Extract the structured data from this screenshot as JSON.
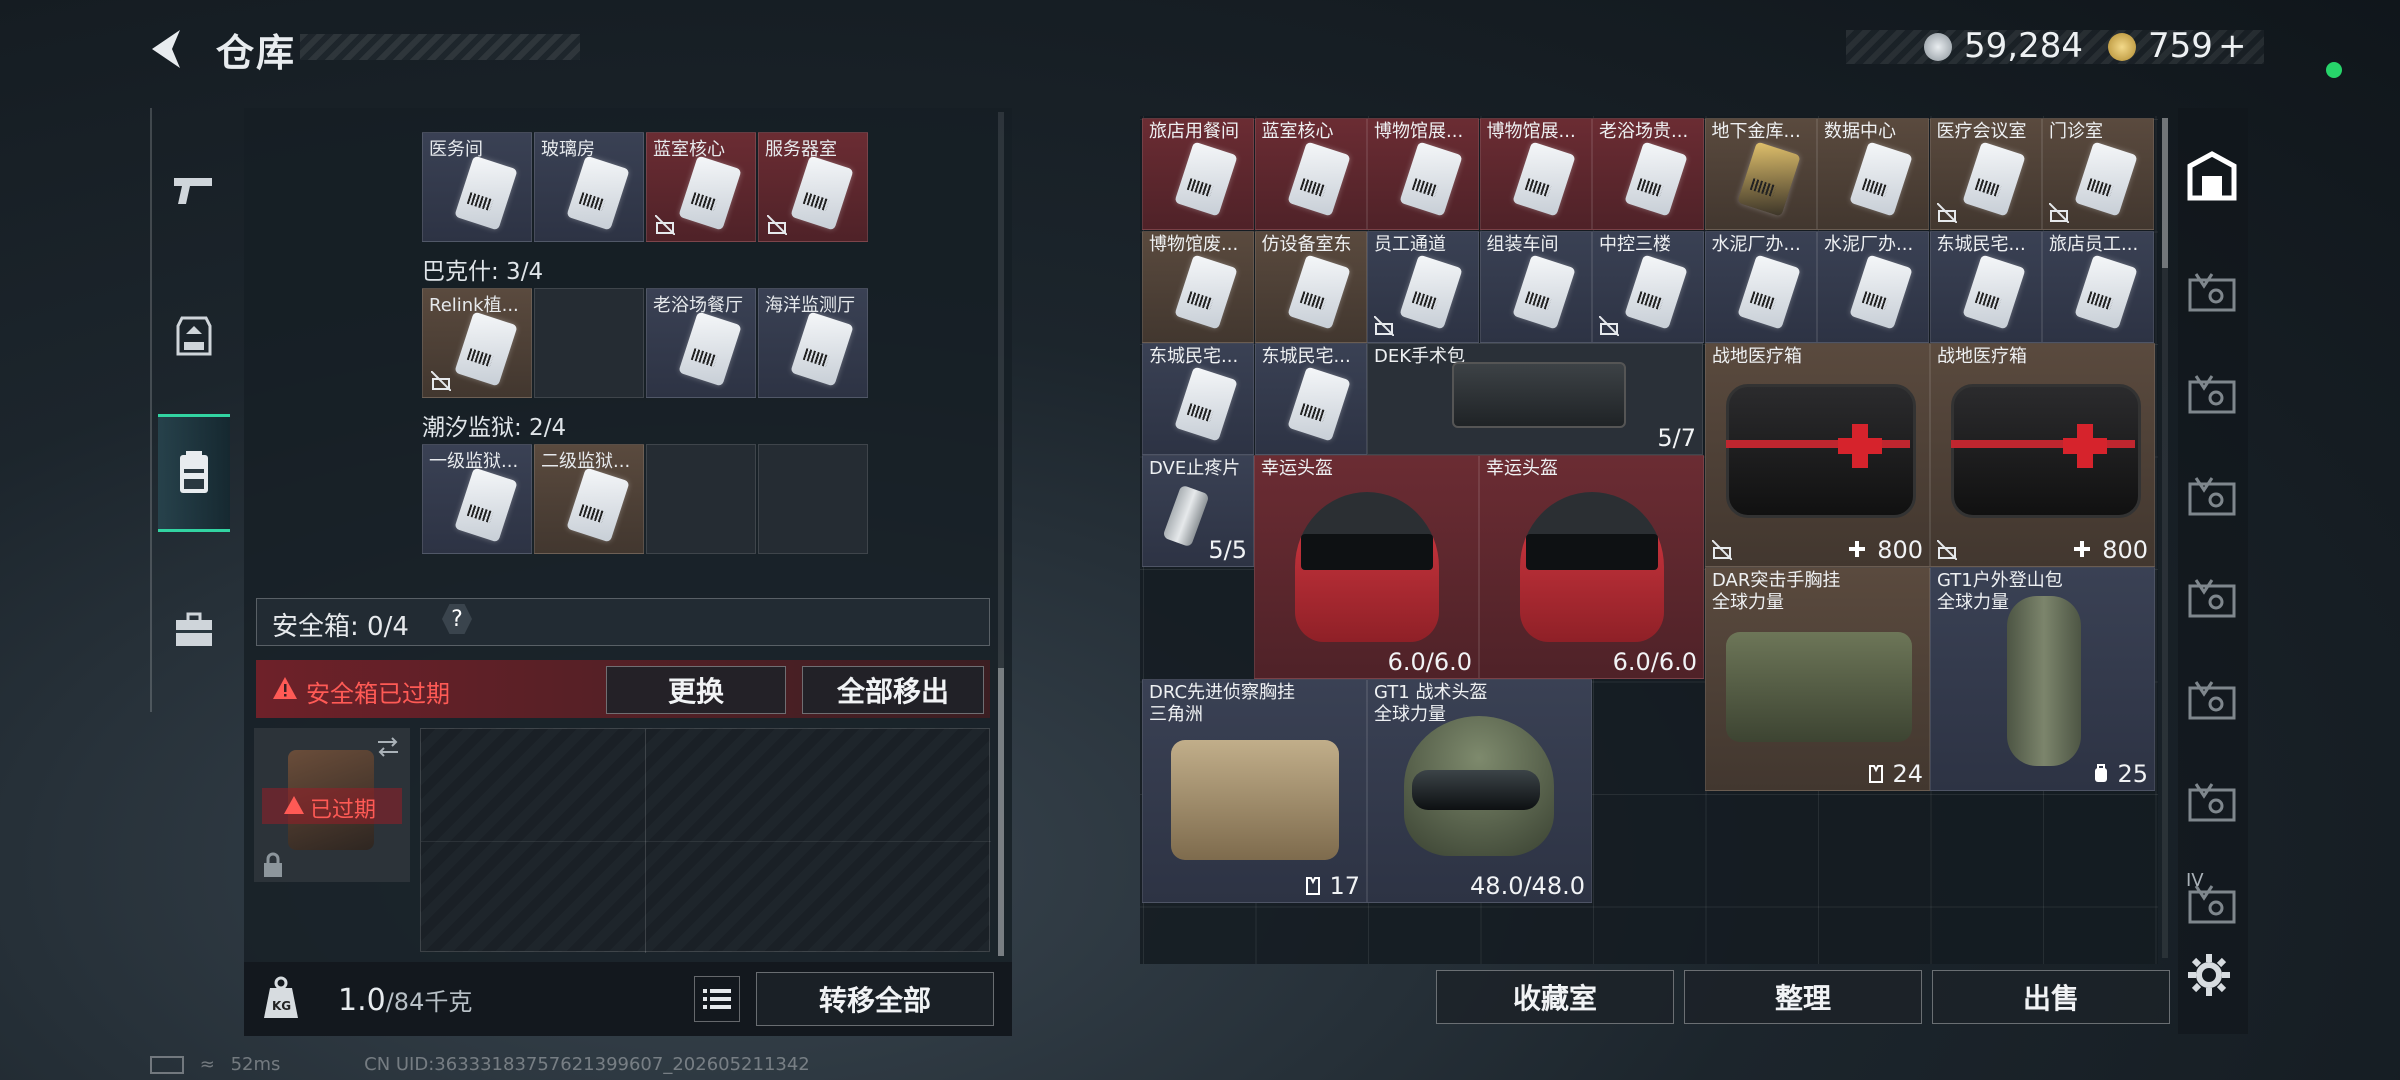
{
  "header": {
    "title": "仓库",
    "currency_silver": "59,284",
    "currency_gold": "759",
    "gold_plus": "+"
  },
  "sidebar": {
    "items": [
      {
        "icon": "pistol-icon"
      },
      {
        "icon": "armor-vest-icon"
      },
      {
        "icon": "backpack-icon"
      },
      {
        "icon": "briefcase-icon"
      }
    ],
    "active_index": 2
  },
  "left_panel": {
    "top_group": {
      "cards": [
        {
          "label": "医务间",
          "bg": "blue",
          "locked": false
        },
        {
          "label": "玻璃房",
          "bg": "blue",
          "locked": false
        },
        {
          "label": "蓝室核心",
          "bg": "red",
          "locked": true
        },
        {
          "label": "服务器室",
          "bg": "red",
          "locked": true
        }
      ]
    },
    "groups": [
      {
        "title": "巴克什: 3/4",
        "cards": [
          {
            "label": "Relink植...",
            "bg": "brown",
            "locked": true
          },
          {
            "label": "",
            "bg": "empty",
            "locked": false
          },
          {
            "label": "老浴场餐厅",
            "bg": "blue",
            "locked": false
          },
          {
            "label": "海洋监测厅",
            "bg": "blue",
            "locked": false
          }
        ]
      },
      {
        "title": "潮汐监狱: 2/4",
        "cards": [
          {
            "label": "一级监狱...",
            "bg": "blue",
            "locked": false
          },
          {
            "label": "二级监狱...",
            "bg": "brown",
            "locked": false
          },
          {
            "label": "",
            "bg": "empty",
            "locked": false
          },
          {
            "label": "",
            "bg": "empty",
            "locked": false
          }
        ]
      }
    ],
    "safebox": {
      "label": "安全箱: 0/4",
      "help": "?",
      "expired_warning": "安全箱已过期",
      "replace_button": "更换",
      "move_all_button": "全部移出",
      "thumb_overlay": "已过期"
    },
    "weight": {
      "current": "1.0",
      "max": "/84千克",
      "transfer_all_button": "转移全部"
    }
  },
  "right_panel": {
    "row1": [
      "旅店用餐间",
      "蓝室核心",
      "博物馆展...",
      "博物馆展...",
      "老浴场贵...",
      "地下金库...",
      "数据中心",
      "医疗会议室",
      "门诊室"
    ],
    "row2": [
      "博物馆废...",
      "仿设备室东",
      "员工通道",
      "组装车间",
      "中控三楼",
      "水泥厂办...",
      "水泥厂办...",
      "东城民宅...",
      "旅店员工..."
    ],
    "row3": [
      "东城民宅...",
      "东城民宅..."
    ],
    "items": {
      "dek_kit": {
        "label": "DEK手术包",
        "count": "5/7"
      },
      "med_box_1": {
        "label": "战地医疗箱",
        "value": "800"
      },
      "med_box_2": {
        "label": "战地医疗箱",
        "value": "800"
      },
      "dve": {
        "label": "DVE止疼片",
        "count": "5/5"
      },
      "helmet_1": {
        "label": "幸运头盔",
        "durability": "6.0/6.0"
      },
      "helmet_2": {
        "label": "幸运头盔",
        "durability": "6.0/6.0"
      },
      "dar_vest": {
        "label": "DAR突击手胸挂",
        "sub": "全球力量",
        "count": "24"
      },
      "gt1_bag": {
        "label": "GT1户外登山包",
        "sub": "全球力量",
        "count": "25"
      },
      "drc_vest": {
        "label": "DRC先进侦察胸挂",
        "sub": "三角洲",
        "count": "17"
      },
      "gt1_helmet": {
        "label": "GT1 战术头盔",
        "sub": "全球力量",
        "durability": "48.0/48.0"
      }
    },
    "buttons": {
      "collection": "收藏室",
      "organize": "整理",
      "sell": "出售"
    }
  },
  "right_tabs": [
    "home-vault-icon",
    "vault-tab-icon",
    "vault-tab-icon",
    "vault-tab-icon",
    "vault-tab-icon",
    "vault-tab-icon",
    "vault-tab-icon",
    "vault-tab-icon"
  ],
  "right_tab_last_label": "IV",
  "status": {
    "ping": "52ms",
    "uid": "CN UID:36333183757621399607_202605211342"
  },
  "colors": {
    "accent_green": "#32d4a2",
    "warning_red": "#ff5a55",
    "status_dot": "#27d46a"
  }
}
